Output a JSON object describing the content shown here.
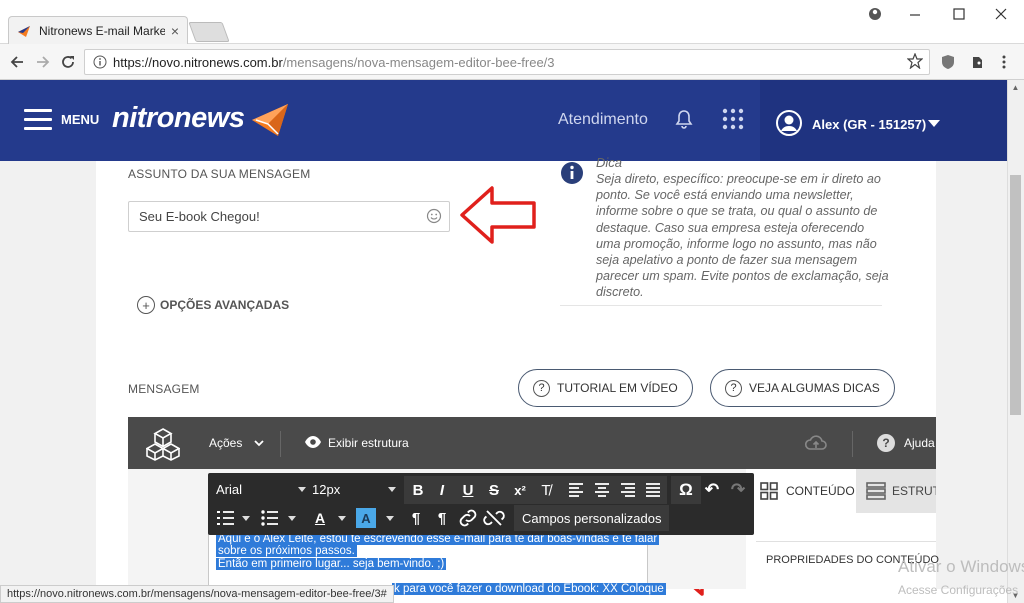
{
  "browser": {
    "tab_title": "Nitronews E-mail Marketi",
    "tab_close": "×",
    "url_scheme": "https://",
    "url_host": "novo.nitronews.com.br",
    "url_path": "/mensagens/nova-mensagem-editor-bee-free/3",
    "status_url": "https://novo.nitronews.com.br/mensagens/nova-mensagem-editor-bee-free/3#"
  },
  "header": {
    "menu_label": "MENU",
    "logo_text": "nitronews",
    "support_link": "Atendimento",
    "user_name": "Alex (GR - 151257)",
    "colors": {
      "bar": "#243a8c",
      "user_area": "#1f3380",
      "logo_accent": "#f47b20"
    }
  },
  "subject": {
    "label": "ASSUNTO DA SUA MENSAGEM",
    "value": "Seu E-book Chegou!"
  },
  "tip": {
    "title": "Dica",
    "text": "Seja direto, específico: preocupe-se em ir direto ao ponto. Se você está enviando uma newsletter, informe sobre o que se trata, ou qual o assunto de destaque. Caso sua empresa esteja oferecendo uma promoção, informe logo no assunto, mas não seja apelativo a ponto de fazer sua mensagem parecer um spam. Evite pontos de exclamação, seja discreto."
  },
  "advanced_options": {
    "label": "OPÇÕES AVANÇADAS",
    "icon": "+"
  },
  "message": {
    "label": "MENSAGEM",
    "tutorial_button": "TUTORIAL EM VÍDEO",
    "tips_button": "VEJA ALGUMAS DICAS",
    "help_glyph": "?"
  },
  "editor_bar": {
    "actions_label": "Ações",
    "show_structure_label": "Exibir estrutura",
    "help_label": "Ajuda"
  },
  "rte": {
    "font": "Arial",
    "size": "12px",
    "custom_fields": "Campos personalizados",
    "bold": "B",
    "italic": "I",
    "underline": "U",
    "strike": "S",
    "superscript": "x²",
    "clear": "T̸",
    "omega": "Ω",
    "undo": "↶",
    "redo": "↷",
    "font_color": "A",
    "bg_color": "A",
    "ltr": "¶",
    "rtl": "¶",
    "link": "🔗",
    "unlink": "⛓"
  },
  "editor_text": {
    "line1": "Aqui é o Alex Leite, estou te escrevendo esse e-mail para te dar boas-vindas e te falar",
    "line2": "sobre os próximos passos.",
    "line3": "Então em primeiro lugar... seja bem-vindo. ;)",
    "line4": "k para você fazer o download do Ebook: XX Coloque"
  },
  "side_panel": {
    "content_tab": "CONTEÚDO",
    "structure_tab": "ESTRUTURA",
    "properties_label": "PROPRIEDADES DO CONTEÚDO"
  },
  "watermark": {
    "line1": "Ativar o Windows",
    "line2": "Acesse Configurações"
  }
}
